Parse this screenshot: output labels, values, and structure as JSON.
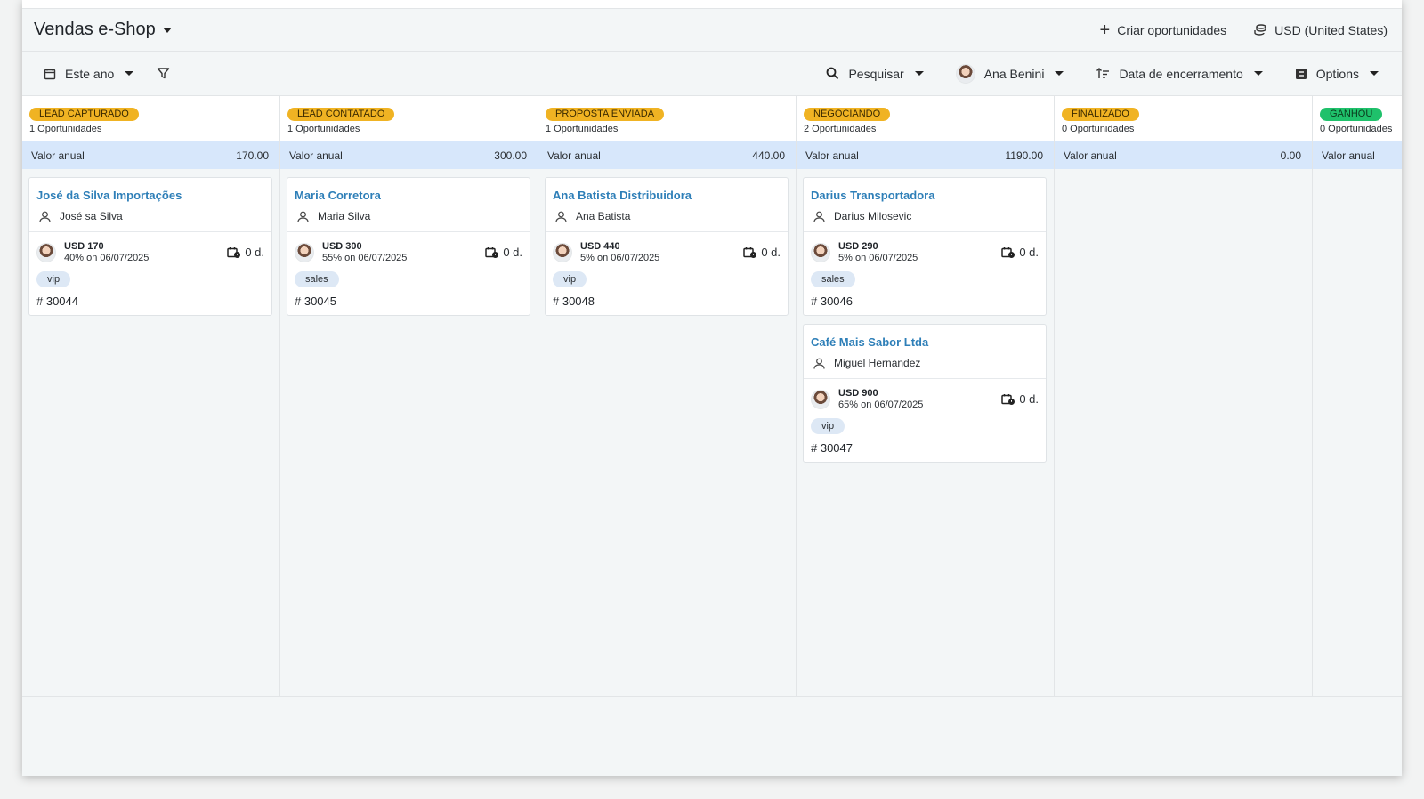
{
  "app": {
    "title": "Vendas e-Shop"
  },
  "header": {
    "create_label": "Criar oportunidades",
    "currency_label": "USD (United States)"
  },
  "toolbar": {
    "period_label": "Este ano",
    "search_label": "Pesquisar",
    "user_label": "Ana Benini",
    "sort_label": "Data de encerramento",
    "options_label": "Options"
  },
  "columns": [
    {
      "stage": "LEAD CAPTURADO",
      "count": "1 Oportunidades",
      "sum_label": "Valor anual",
      "sum_value": "170.00",
      "badge_color": "#f0b323",
      "cards": [
        {
          "title": "José da Silva Importações",
          "contact": "José sa Silva",
          "amount": "USD 170",
          "prob": "40% on 06/07/2025",
          "days": "0 d.",
          "tag": "vip",
          "ref": "# 30044"
        }
      ]
    },
    {
      "stage": "LEAD CONTATADO",
      "count": "1 Oportunidades",
      "sum_label": "Valor anual",
      "sum_value": "300.00",
      "badge_color": "#f0b323",
      "cards": [
        {
          "title": "Maria Corretora",
          "contact": "Maria Silva",
          "amount": "USD 300",
          "prob": "55% on 06/07/2025",
          "days": "0 d.",
          "tag": "sales",
          "ref": "# 30045"
        }
      ]
    },
    {
      "stage": "PROPOSTA ENVIADA",
      "count": "1 Oportunidades",
      "sum_label": "Valor anual",
      "sum_value": "440.00",
      "badge_color": "#f0b323",
      "cards": [
        {
          "title": "Ana Batista Distribuidora",
          "contact": "Ana Batista",
          "amount": "USD 440",
          "prob": "5% on 06/07/2025",
          "days": "0 d.",
          "tag": "vip",
          "ref": "# 30048"
        }
      ]
    },
    {
      "stage": "NEGOCIANDO",
      "count": "2 Oportunidades",
      "sum_label": "Valor anual",
      "sum_value": "1190.00",
      "badge_color": "#f0b323",
      "cards": [
        {
          "title": "Darius Transportadora",
          "contact": "Darius Milosevic",
          "amount": "USD 290",
          "prob": "5% on 06/07/2025",
          "days": "0 d.",
          "tag": "sales",
          "ref": "# 30046"
        },
        {
          "title": "Café Mais Sabor Ltda",
          "contact": "Miguel Hernandez",
          "amount": "USD 900",
          "prob": "65% on 06/07/2025",
          "days": "0 d.",
          "tag": "vip",
          "ref": "# 30047"
        }
      ]
    },
    {
      "stage": "FINALIZADO",
      "count": "0 Oportunidades",
      "sum_label": "Valor anual",
      "sum_value": "0.00",
      "badge_color": "#f0b323",
      "cards": []
    },
    {
      "stage": "GANHOU",
      "count": "0 Oportunidades",
      "sum_label": "Valor anual",
      "sum_value": "",
      "badge_color": "#1fc16b",
      "cards": []
    }
  ]
}
